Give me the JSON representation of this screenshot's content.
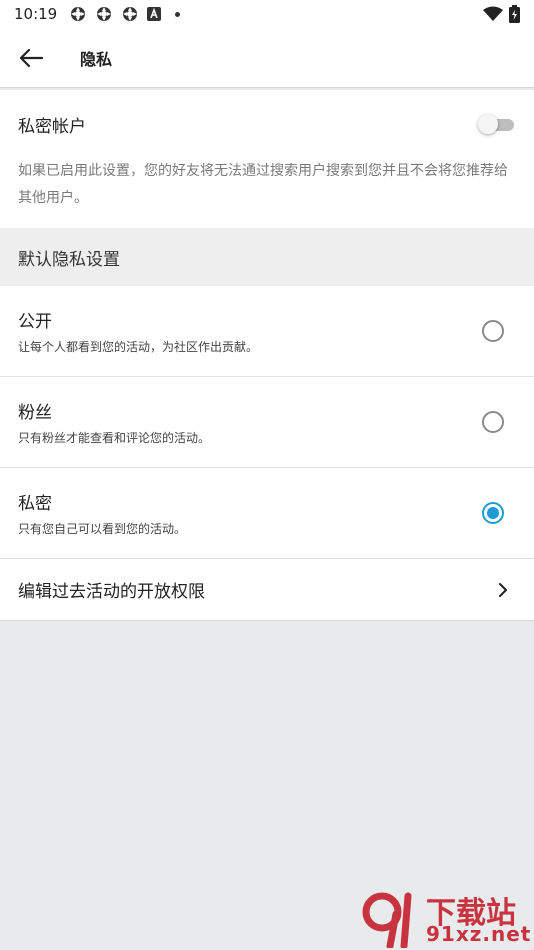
{
  "status_bar": {
    "time": "10:19",
    "icons_left": [
      "gear-icon",
      "gear-icon",
      "gear-icon",
      "a-icon"
    ],
    "icons_right": [
      "wifi-icon",
      "battery-icon"
    ]
  },
  "app_bar": {
    "title": "隐私",
    "back_icon": "arrow-left-icon"
  },
  "private_account": {
    "label": "私密帐户",
    "enabled": false,
    "description": "如果已启用此设置，您的好友将无法通过搜索用户搜索到您并且不会将您推荐给其他用户。"
  },
  "default_privacy": {
    "header": "默认隐私设置",
    "options": [
      {
        "title": "公开",
        "subtitle": "让每个人都看到您的活动，为社区作出贡献。",
        "selected": false
      },
      {
        "title": "粉丝",
        "subtitle": "只有粉丝才能查看和评论您的活动。",
        "selected": false
      },
      {
        "title": "私密",
        "subtitle": "只有您自己可以看到您的活动。",
        "selected": true
      }
    ]
  },
  "edit_past": {
    "label": "编辑过去活动的开放权限",
    "icon": "chevron-right-icon"
  },
  "watermark": {
    "line1": "下载站",
    "line2": "91xz.net"
  },
  "colors": {
    "accent": "#1e9bd7",
    "section_bg": "#eeeeee",
    "page_bg": "#e8eaec",
    "watermark": "#c7343f"
  }
}
